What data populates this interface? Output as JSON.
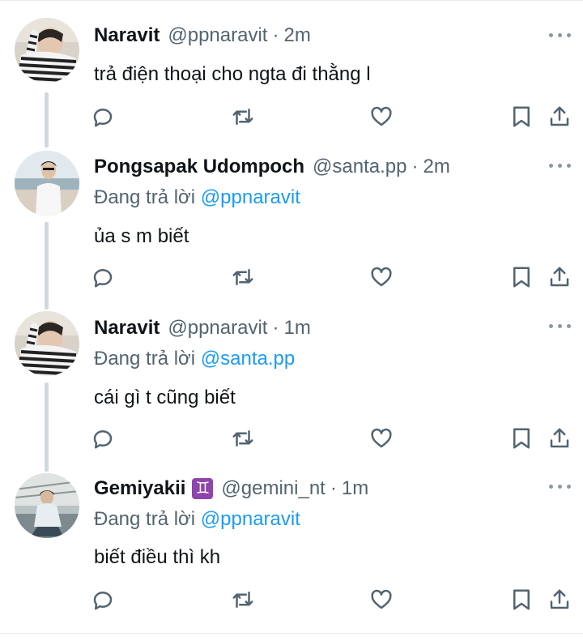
{
  "tweets": [
    {
      "name": "Naravit",
      "handle": "@ppnaravit",
      "separator": "·",
      "time": "2m",
      "reply_prefix": "",
      "reply_to": "",
      "text": "trả điện thoại cho ngta đi thằng l",
      "avatar": "naravit-avatar"
    },
    {
      "name": "Pongsapak Udompoch",
      "handle": "@santa.pp",
      "separator": "·",
      "time": "2m",
      "reply_prefix": "Đang trả lời ",
      "reply_to": "@ppnaravit",
      "text": "ủa s m biết",
      "avatar": "pongsapak-avatar"
    },
    {
      "name": "Naravit",
      "handle": "@ppnaravit",
      "separator": "·",
      "time": "1m",
      "reply_prefix": "Đang trả lời ",
      "reply_to": "@santa.pp",
      "text": "cái gì t cũng biết",
      "avatar": "naravit-avatar"
    },
    {
      "name": "Gemiyakii",
      "badge": "♊",
      "handle": "@gemini_nt",
      "separator": "·",
      "time": "1m",
      "reply_prefix": "Đang trả lời ",
      "reply_to": "@ppnaravit",
      "text": "biết điều thì kh",
      "avatar": "gemiyakii-avatar"
    }
  ],
  "icons": {
    "reply": "reply-icon",
    "retweet": "retweet-icon",
    "like": "heart-icon",
    "bookmark": "bookmark-icon",
    "share": "share-icon",
    "more": "more-icon"
  },
  "colors": {
    "accent": "#1d9bf0",
    "muted": "#536471",
    "text": "#0f1419",
    "thread_line": "#cfd9de",
    "zodiac_badge": "#8e44ad"
  }
}
